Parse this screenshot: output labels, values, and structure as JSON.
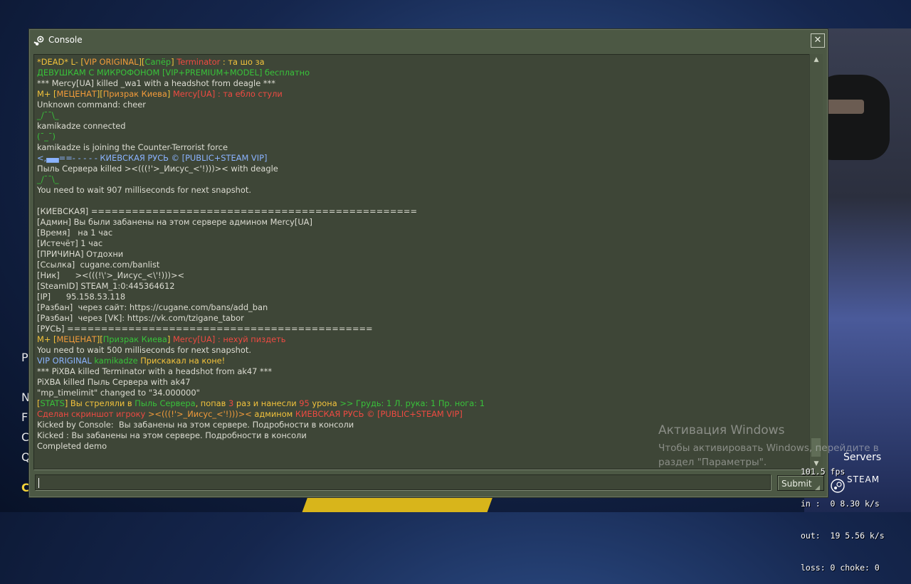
{
  "window": {
    "title": "Console",
    "close_label": "✕"
  },
  "colors": {
    "white": "#dcdcd2",
    "yellow": "#f2c23c",
    "orange": "#f29b3a",
    "green": "#38c23a",
    "red": "#ef4a42",
    "blue": "#8ab3ff",
    "lime": "#6fd46e",
    "cyan": "#9ad8f5"
  },
  "log": [
    [
      {
        "t": "*DEAD* L- [",
        "c": "yellow"
      },
      {
        "t": "VIP ORIGINAL",
        "c": "orange"
      },
      {
        "t": "][",
        "c": "yellow"
      },
      {
        "t": "Сапёр",
        "c": "green"
      },
      {
        "t": "] ",
        "c": "yellow"
      },
      {
        "t": "Terminator",
        "c": "red"
      },
      {
        "t": " : та шо за",
        "c": "yellow"
      }
    ],
    [
      {
        "t": "ДЕВУШКАМ С МИКРОФОНОМ [VIP+PREMIUM+MODEL] бесплатно",
        "c": "green"
      }
    ],
    [
      {
        "t": "*** Mercy[UA] killed _wa1 with a headshot from deagle ***",
        "c": "white"
      }
    ],
    [
      {
        "t": "M+ [",
        "c": "yellow"
      },
      {
        "t": "МЕЦЕНАТ",
        "c": "orange"
      },
      {
        "t": "][",
        "c": "yellow"
      },
      {
        "t": "Призрак Киева",
        "c": "orange"
      },
      {
        "t": "] ",
        "c": "yellow"
      },
      {
        "t": "Mercy[UA]",
        "c": "red"
      },
      {
        "t": " : та ебло стули",
        "c": "red"
      }
    ],
    [
      {
        "t": "Unknown command: cheer",
        "c": "white"
      }
    ],
    [
      {
        "t": "_/¯¯\\_",
        "c": "green"
      }
    ],
    [
      {
        "t": "kamikadze connected",
        "c": "white"
      }
    ],
    [
      {
        "t": "(¯_¯)",
        "c": "green"
      }
    ],
    [
      {
        "t": "kamikadze is joining the Counter-Terrorist force",
        "c": "white"
      }
    ],
    [
      {
        "t": "<,▄▄==- - - - - КИЕВСКАЯ РУСЬ © [PUBLIC+STEAM VIP]",
        "c": "blue"
      }
    ],
    [
      {
        "t": "Пыль Сервера killed ><(((!'>_Иисус_<'!)))>< with deagle",
        "c": "white"
      }
    ],
    [
      {
        "t": "_/¯¯\\_",
        "c": "green"
      }
    ],
    [
      {
        "t": "You need to wait 907 milliseconds for next snapshot.",
        "c": "white"
      }
    ],
    [
      {
        "t": "",
        "c": "white"
      }
    ],
    [
      {
        "t": "[КИЕВСКАЯ] ================================================",
        "c": "white"
      }
    ],
    [
      {
        "t": "[Админ] Вы были забанены на этом сервере админом Mercy[UA]",
        "c": "white"
      }
    ],
    [
      {
        "t": "[Время]   на 1 час",
        "c": "white"
      }
    ],
    [
      {
        "t": "[Истечёт] 1 час",
        "c": "white"
      }
    ],
    [
      {
        "t": "[ПРИЧИНА] Отдохни",
        "c": "white"
      }
    ],
    [
      {
        "t": "[Ссылка]  cugane.com/banlist",
        "c": "white"
      }
    ],
    [
      {
        "t": "[Ник]      ><(((!\\'>_Иисус_<\\'!)))><",
        "c": "white"
      }
    ],
    [
      {
        "t": "[SteamID] STEAM_1:0:445364612",
        "c": "white"
      }
    ],
    [
      {
        "t": "[IP]      95.158.53.118",
        "c": "white"
      }
    ],
    [
      {
        "t": "[Разбан]  через сайт: https://cugane.com/bans/add_ban",
        "c": "white"
      }
    ],
    [
      {
        "t": "[Разбан]  через [VK]: https://vk.com/tzigane_tabor",
        "c": "white"
      }
    ],
    [
      {
        "t": "[РУСЬ] =============================================",
        "c": "white"
      }
    ],
    [
      {
        "t": "M+ [",
        "c": "yellow"
      },
      {
        "t": "МЕЦЕНАТ",
        "c": "orange"
      },
      {
        "t": "][",
        "c": "yellow"
      },
      {
        "t": "Призрак Киева",
        "c": "green"
      },
      {
        "t": "] ",
        "c": "yellow"
      },
      {
        "t": "Mercy[UA]",
        "c": "red"
      },
      {
        "t": " : нехуй пиздеть",
        "c": "red"
      }
    ],
    [
      {
        "t": "You need to wait 500 milliseconds for next snapshot.",
        "c": "white"
      }
    ],
    [
      {
        "t": "VIP ORIGINAL",
        "c": "blue"
      },
      {
        "t": " kamikadze",
        "c": "green"
      },
      {
        "t": " Прискакал на коне!",
        "c": "yellow"
      }
    ],
    [
      {
        "t": "*** PiXBA killed Terminator with a headshot from ak47 ***",
        "c": "white"
      }
    ],
    [
      {
        "t": "PiXBA killed Пыль Сервера with ak47",
        "c": "white"
      }
    ],
    [
      {
        "t": "\"mp_timelimit\" changed to \"34.000000\"",
        "c": "white"
      }
    ],
    [
      {
        "t": "[",
        "c": "yellow"
      },
      {
        "t": "STATS",
        "c": "green"
      },
      {
        "t": "] Вы стреляли в ",
        "c": "yellow"
      },
      {
        "t": "Пыль Сервера",
        "c": "green"
      },
      {
        "t": ", попав ",
        "c": "yellow"
      },
      {
        "t": "3",
        "c": "red"
      },
      {
        "t": " раз и нанесли ",
        "c": "yellow"
      },
      {
        "t": "95",
        "c": "red"
      },
      {
        "t": " урона ",
        "c": "yellow"
      },
      {
        "t": ">> Грудь: 1 Л. рука: 1 Пр. нога: 1",
        "c": "green"
      }
    ],
    [
      {
        "t": "Сделан скриншот игроку ",
        "c": "red"
      },
      {
        "t": "><(((!'>_Иисус_<'!)))><",
        "c": "orange"
      },
      {
        "t": " админом ",
        "c": "yellow"
      },
      {
        "t": "КИЕВСКАЯ РУСЬ © [PUBLIC+STEAM VIP]",
        "c": "red"
      }
    ],
    [
      {
        "t": "Kicked by Console:  Вы забанены на этом сервере. Подробности в консоли",
        "c": "white"
      }
    ],
    [
      {
        "t": "Kicked : Вы забанены на этом сервере. Подробности в консоли",
        "c": "white"
      }
    ],
    [
      {
        "t": "Completed demo",
        "c": "white"
      }
    ]
  ],
  "input": {
    "value": "",
    "submit_label": "Submit"
  },
  "activation": {
    "title": "Активация Windows",
    "line1": "Чтобы активировать Windows, перейдите в",
    "line2": "раздел \"Параметры\"."
  },
  "netgraph": {
    "fps": "101.5 fps",
    "in": "in :  0 8.30 k/s",
    "out": "out:  19 5.56 k/s",
    "loss": "loss: 0 choke: 0"
  },
  "background": {
    "servers": "Servers",
    "steam": "STEAM",
    "menu_letters": [
      "P",
      "N",
      "F",
      "C",
      "Q",
      "C"
    ]
  }
}
